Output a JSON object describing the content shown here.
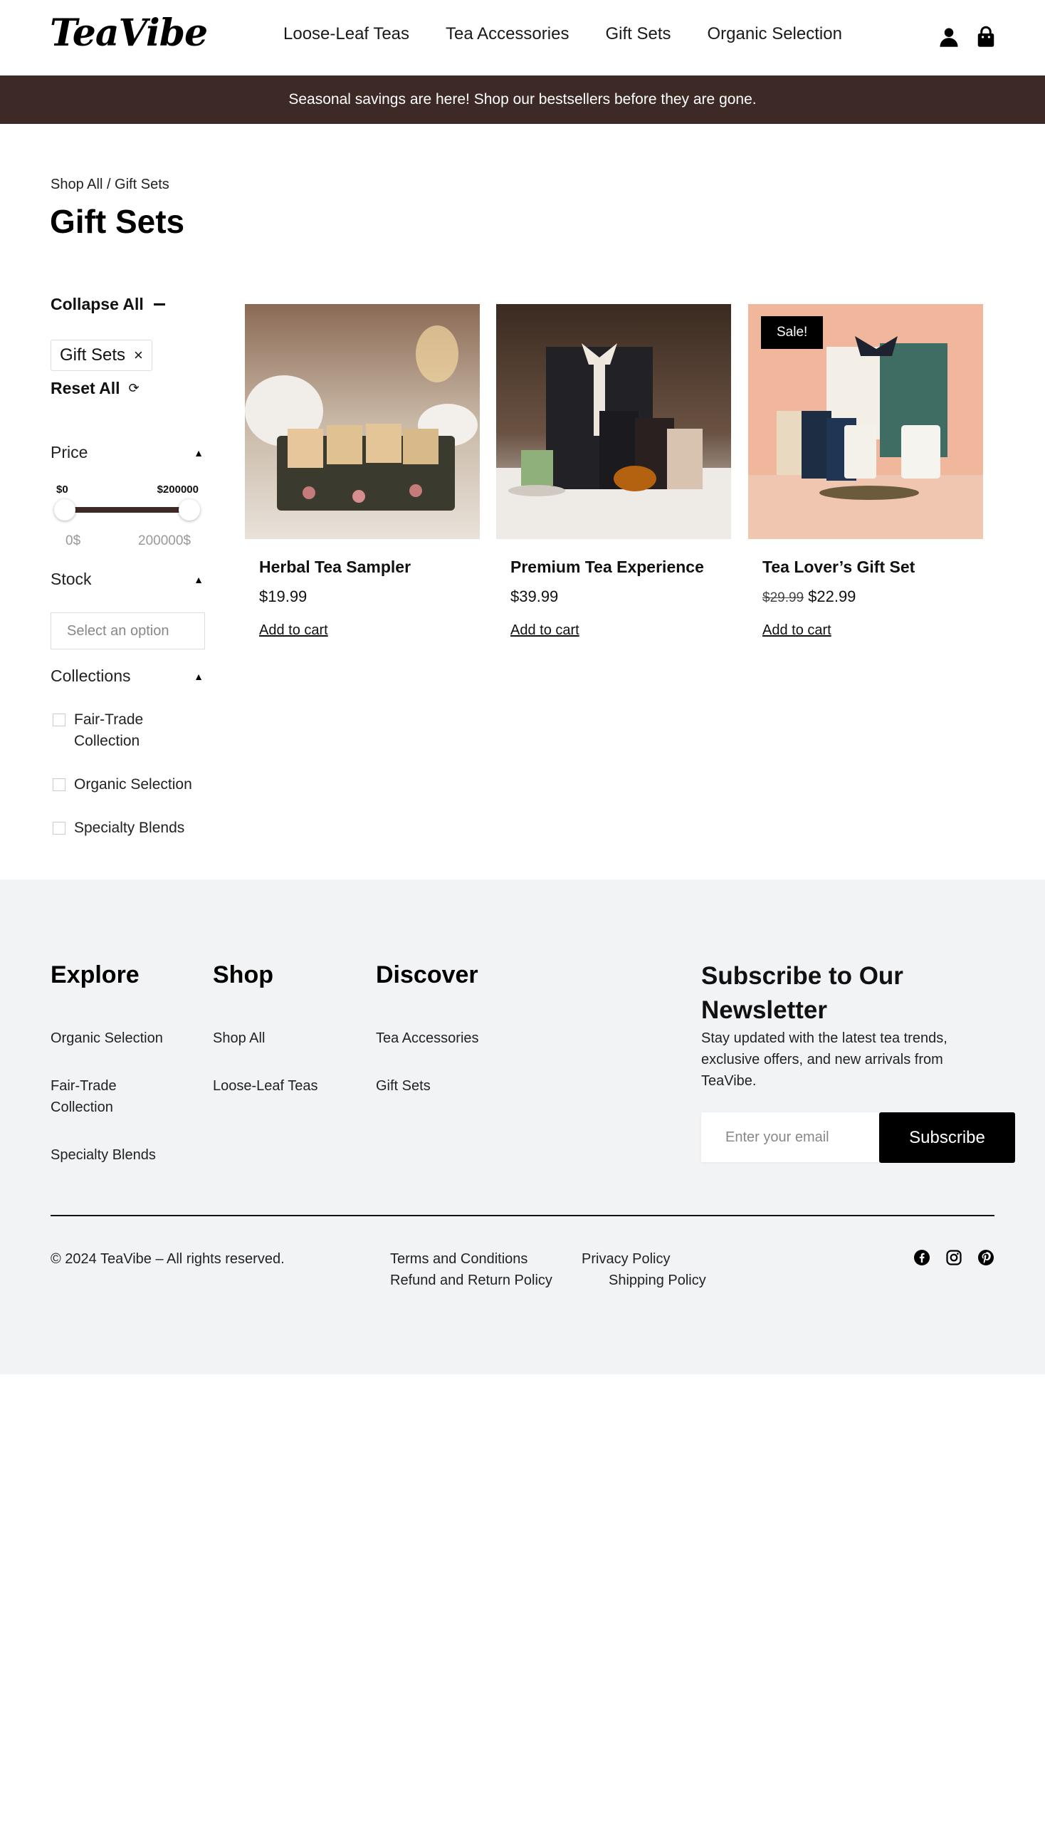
{
  "header": {
    "logo": "TeaVibe",
    "nav": [
      "Loose-Leaf Teas",
      "Tea Accessories",
      "Gift Sets",
      "Organic Selection"
    ]
  },
  "banner": "Seasonal savings are here! Shop our bestsellers before they are gone.",
  "breadcrumb": "Shop All / Gift Sets",
  "page_title": "Gift Sets",
  "sidebar": {
    "collapse_all": "Collapse All",
    "chip": "Gift Sets",
    "reset_all": "Reset All",
    "price": {
      "label": "Price",
      "min_label": "$0",
      "max_label": "$200000",
      "min_value": "0$",
      "max_value": "200000$"
    },
    "stock": {
      "label": "Stock",
      "placeholder": "Select an option"
    },
    "collections": {
      "label": "Collections",
      "items": [
        "Fair-Trade Collection",
        "Organic Selection",
        "Specialty Blends"
      ]
    }
  },
  "products": [
    {
      "name": "Herbal Tea Sampler",
      "price": "$19.99",
      "old_price": "",
      "cta": "Add to cart"
    },
    {
      "name": "Premium Tea Experience",
      "price": "$39.99",
      "old_price": "",
      "cta": "Add to cart"
    },
    {
      "name": "Tea Lover’s Gift Set",
      "price": "$22.99",
      "old_price": "$29.99",
      "cta": "Add to cart",
      "badge": "Sale!"
    }
  ],
  "footer": {
    "explore": {
      "title": "Explore",
      "links": [
        "Organic Selection",
        "Fair-Trade Collection",
        "Specialty Blends"
      ]
    },
    "shop": {
      "title": "Shop",
      "links": [
        "Shop All",
        "Loose-Leaf Teas"
      ]
    },
    "discover": {
      "title": "Discover",
      "links": [
        "Tea Accessories",
        "Gift Sets"
      ]
    },
    "newsletter": {
      "title": "Subscribe to Our Newsletter",
      "text": "Stay updated with the latest tea trends, exclusive offers, and new arrivals from TeaVibe.",
      "placeholder": "Enter your email",
      "button": "Subscribe"
    },
    "copyright": "© 2024 TeaVibe – All rights reserved.",
    "legal": [
      "Terms and Conditions",
      "Privacy Policy",
      "Refund and Return Policy",
      "Shipping Policy"
    ],
    "social": [
      "facebook-icon",
      "instagram-icon",
      "pinterest-icon"
    ]
  },
  "colors": {
    "banner": "#3d2a26",
    "footer_bg": "#f2f3f5",
    "accent": "#000000"
  }
}
